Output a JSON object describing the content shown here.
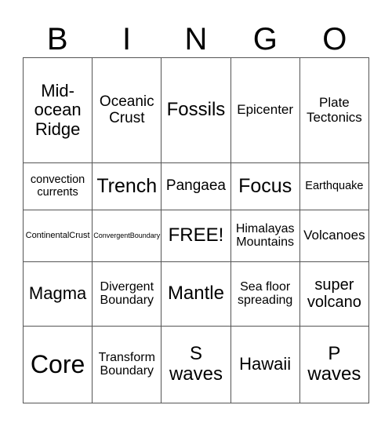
{
  "header": {
    "letters": [
      "B",
      "I",
      "N",
      "G",
      "O"
    ]
  },
  "grid": {
    "rows": [
      [
        "Mid-ocean Ridge",
        "Oceanic Crust",
        "Fossils",
        "Epicenter",
        "Plate Tectonics"
      ],
      [
        "convection currents",
        "Trench",
        "Pangaea",
        "Focus",
        "Earthquake"
      ],
      [
        "ContinentalCrust",
        "ConvergentBoundary",
        "FREE!",
        "Himalayas Mountains",
        "Volcanoes"
      ],
      [
        "Magma",
        "Divergent Boundary",
        "Mantle",
        "Sea floor spreading",
        "super volcano"
      ],
      [
        "Core",
        "Transform Boundary",
        "S waves",
        "Hawaii",
        "P waves"
      ]
    ]
  }
}
